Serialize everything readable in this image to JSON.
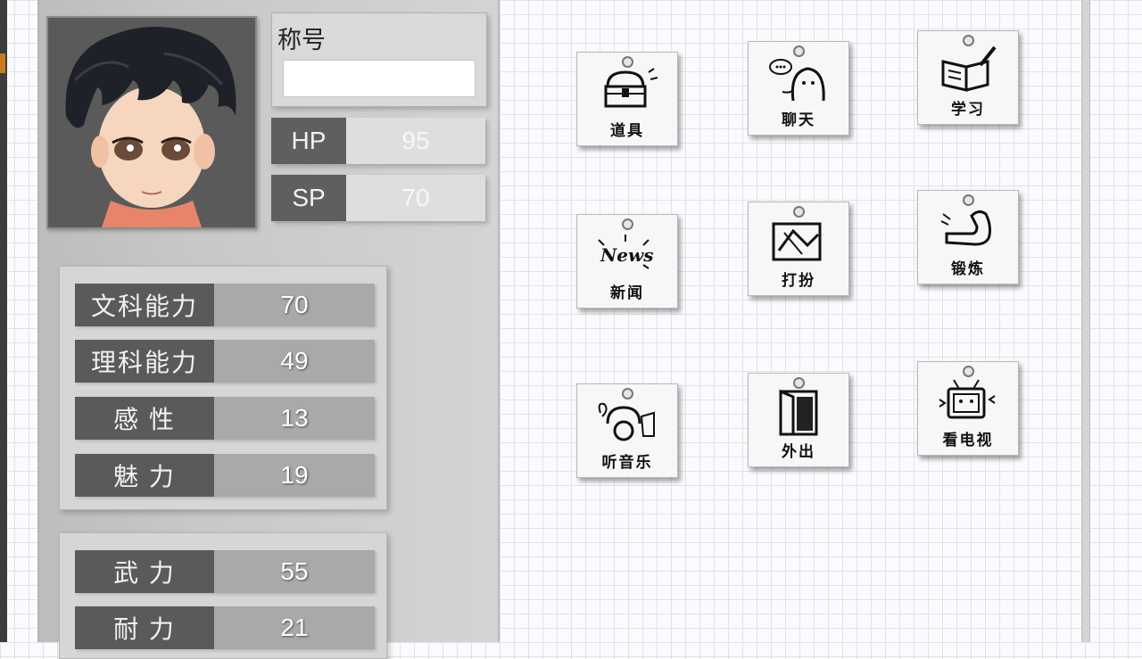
{
  "profile": {
    "title_label": "称号",
    "title_value": "",
    "hp": {
      "label": "HP",
      "value": "95"
    },
    "sp": {
      "label": "SP",
      "value": "70"
    }
  },
  "attributes_group1": [
    {
      "label": "文科能力",
      "value": "70"
    },
    {
      "label": "理科能力",
      "value": "49"
    },
    {
      "label": "感 性",
      "value": "13"
    },
    {
      "label": "魅 力",
      "value": "19"
    }
  ],
  "attributes_group2": [
    {
      "label": "武 力",
      "value": "55"
    },
    {
      "label": "耐 力",
      "value": "21"
    }
  ],
  "actions": [
    {
      "label": "道具",
      "icon": "treasure-chest-icon"
    },
    {
      "label": "聊天",
      "icon": "chat-bubble-icon"
    },
    {
      "label": "学习",
      "icon": "book-pen-icon"
    },
    {
      "label": "新闻",
      "icon": "news-icon"
    },
    {
      "label": "打扮",
      "icon": "dress-up-icon"
    },
    {
      "label": "锻炼",
      "icon": "flexed-arm-icon"
    },
    {
      "label": "听音乐",
      "icon": "music-icon"
    },
    {
      "label": "外出",
      "icon": "door-icon"
    },
    {
      "label": "看电视",
      "icon": "tv-icon"
    }
  ]
}
